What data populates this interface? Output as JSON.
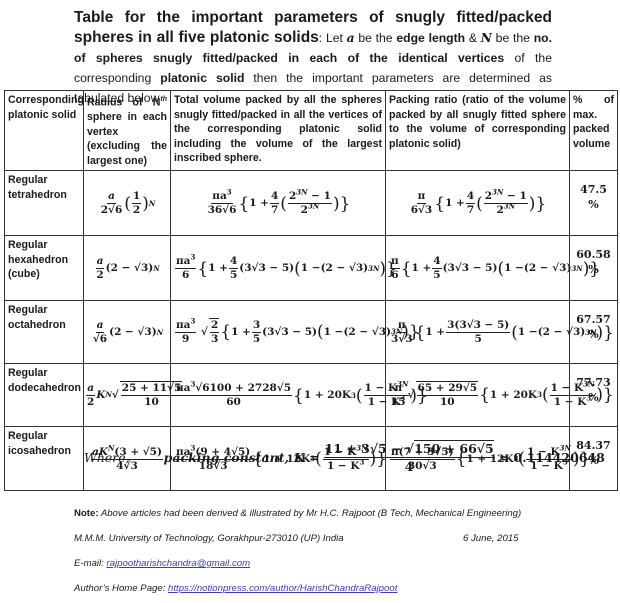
{
  "intro": {
    "title": "Table for the important parameters of snugly fitted/packed spheres in all five platonic solids",
    "colon": ":",
    "t1": " Let ",
    "var_a": "a",
    "t2": " be the ",
    "b1": "edge length",
    "t3": " & ",
    "var_N": "N",
    "t4": " be the ",
    "b2": "no. of spheres snugly fitted/packed in each of the identical vertices",
    "t5": " of the corresponding ",
    "b3": "platonic solid",
    "t6": " then the important parameters are determined as tabulated below"
  },
  "table": {
    "headers": [
      "Corresponding platonic solid",
      "Radius of N",
      "Total volume packed by all the spheres snugly fitted/packed in all the vertices of the corresponding platonic solid including the volume of the largest inscribed sphere.",
      "Packing ratio (ratio of the volume packed by all snugly fitted sphere to the volume of corresponding platonic solid)",
      "% of max. packed volume"
    ],
    "header_radius_sup": "th",
    "header_radius_rest": " sphere in each vertex (excluding the largest one)",
    "rows": [
      {
        "name": "Regular tetrahedron",
        "radius": "a/(2√6) · (1/2)^N",
        "volume": "πa³/(36√6) {1 + 4/7 ((2^3N − 1)/2^3N)}",
        "ratio": "π/(6√3) {1 + 4/7 ((2^3N − 1)/2^3N)}",
        "percent": "47.5 %"
      },
      {
        "name": "Regular hexahedron (cube)",
        "radius": "a/2 (2 − √3)^N",
        "volume": "πa³/6 {1 + 4/5 (3√3 − 5)(1 − (2 − √3)^3N)}",
        "ratio": "π/6 {1 + 4/5 (3√3 − 5)(1 − (2 − √3)^3N)}",
        "percent": "60.58 %"
      },
      {
        "name": "Regular octahedron",
        "radius": "a/√6 (2 − √3)^N",
        "volume": "πa³/9 √(2/3) {1 + 3/5 (3√3 − 5)(1 − (2 − √3)^3N)}",
        "ratio": "π/(3√3) {1 + 3(3√3 − 5)/5 (1 − (2 − √3)^3N)}",
        "percent": "67.57 %"
      },
      {
        "name": "Regular dodecahedron",
        "radius": "a/2 K^N √((25 + 11√5)/10)",
        "volume": "πa³√(6100 + 2728√5)/60 {1 + 20K³ ((1 − K^3N)/(1 − K³))}",
        "ratio": "π/15 √((65 + 29√5)/10) {1 + 20K³ ((1 − K^3N)/(1 − K³))}",
        "percent": "77.73 %"
      },
      {
        "name": "Regular icosahedron",
        "radius": "aK^N(3 + √5)/(4√3)",
        "volume": "πa³(9 + 4√5)/(18√3) {1 + 12K³ ((1 − K^3N)/(1 − K³))}",
        "ratio": "π(7 + 3√5)/(30√3) {1 + 12K³ ((1 − K^3N)/(1 − K³))}",
        "percent": "84.37 %"
      }
    ]
  },
  "constant": {
    "where": "Where,",
    "label": "packing constant,",
    "symbol": "K =",
    "numerator": "11 + 3√5 − √150 + 66√5",
    "num_a": "11 + 3√5 − √",
    "num_b": "150 + 66√5",
    "denominator": "4",
    "approx": "≈ 0.114420648"
  },
  "footer": {
    "note_label": "Note:",
    "note_text": " Above articles had been derived & illustrated by Mr H.C. Rajpoot (B Tech, Mechanical Engineering)",
    "university": "M.M.M. University of Technology, Gorakhpur-273010 (UP) India",
    "date": "6 June, 2015",
    "email_label": "E-mail: ",
    "email": "rajpootharishchandra@gmail.com",
    "home_label": "Author’s Home Page: ",
    "home_url": "https://notionpress.com/author/HarishChandraRajpoot"
  },
  "math": {
    "a": "a",
    "N": "N",
    "K": "K",
    "pi_a3": "πa",
    "pi": "π",
    "three": "3",
    "one_plus": "1 + ",
    "two_sqrt6": "2√6",
    "one": "1",
    "two": "2",
    "sqrt6": "√6",
    "paren_l": "(",
    "paren_r": ")",
    "brace_l": "{",
    "brace_r": "}",
    "two_minus_sqrt3": "(2 − √3)",
    "exp_N": "N",
    "exp_3N": "3N",
    "c36": "36√6",
    "c6s3": "6√3",
    "four": "4",
    "seven": "7",
    "five": "5",
    "six": "6",
    "nine": "9",
    "two3N_minus1": "2",
    "minus1": " − 1",
    "two3N": "2",
    "t3s3m5": "(3√3 − 5)",
    "one_minus": "1 − ",
    "two3": "2",
    "three_": "3",
    "three3s3m5": "3(3√3 − 5)",
    "c3s3": "3√3",
    "c25": "25 + 11√5",
    "ten": "10",
    "c6100": "√6100 + 2728√5",
    "sixty": "60",
    "c20K3": "1 + 20K",
    "c12K3": "1 + 12K",
    "oneMinusK": "1 − K",
    "fifteen": "15",
    "c65": "65 + 29√5",
    "aK": "aK",
    "c3ps5": "(3 + √5)",
    "c4s3": "4√3",
    "c9p4s5": "(9 + 4√5)",
    "c18s3": "18√3",
    "c7p3s5": "π(7 + 3√5)",
    "c30s3": "30√3"
  }
}
